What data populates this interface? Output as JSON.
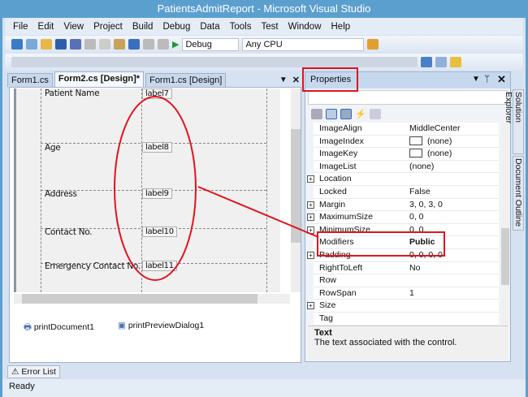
{
  "title": "PatientsAdmitReport - Microsoft Visual Studio",
  "menu": [
    "File",
    "Edit",
    "View",
    "Project",
    "Build",
    "Debug",
    "Data",
    "Tools",
    "Test",
    "Window",
    "Help"
  ],
  "toolbar": {
    "configuration": "Debug",
    "platform": "Any CPU"
  },
  "tabs": [
    "Form1.cs",
    "Form2.cs [Design]*",
    "Form1.cs [Design]"
  ],
  "form": {
    "rows": [
      {
        "label": "Patient Name",
        "value": "label7"
      },
      {
        "label": "Age",
        "value": "label8"
      },
      {
        "label": "Address",
        "value": "label9"
      },
      {
        "label": "Contact No.",
        "value": "label10"
      },
      {
        "label": "Emergency Contact No.",
        "value": "label11"
      }
    ]
  },
  "tray": [
    "printDocument1",
    "printPreviewDialog1"
  ],
  "properties": {
    "title": "Properties",
    "rows": [
      {
        "name": "ImageAlign",
        "value": "MiddleCenter"
      },
      {
        "name": "ImageIndex",
        "value": "(none)",
        "swatch": true
      },
      {
        "name": "ImageKey",
        "value": "(none)",
        "swatch": true
      },
      {
        "name": "ImageList",
        "value": "(none)"
      },
      {
        "name": "Location",
        "value": "",
        "expand": true
      },
      {
        "name": "Locked",
        "value": "False"
      },
      {
        "name": "Margin",
        "value": "3, 0, 3, 0",
        "expand": true
      },
      {
        "name": "MaximumSize",
        "value": "0, 0",
        "expand": true
      },
      {
        "name": "MinimumSize",
        "value": "0, 0",
        "expand": true
      },
      {
        "name": "Modifiers",
        "value": "Public",
        "bold": true
      },
      {
        "name": "Padding",
        "value": "0, 0, 0, 0",
        "expand": true
      },
      {
        "name": "RightToLeft",
        "value": "No"
      },
      {
        "name": "Row",
        "value": ""
      },
      {
        "name": "RowSpan",
        "value": "1"
      },
      {
        "name": "Size",
        "value": "",
        "expand": true
      },
      {
        "name": "Tag",
        "value": ""
      }
    ],
    "desc_title": "Text",
    "desc_text": "The text associated with the control."
  },
  "side_tabs": [
    "Solution Explorer",
    "Document Outline"
  ],
  "error_list": "Error List",
  "status": "Ready",
  "colors": {
    "annotation": "#e0141e",
    "chrome": "#5b9fcf"
  }
}
